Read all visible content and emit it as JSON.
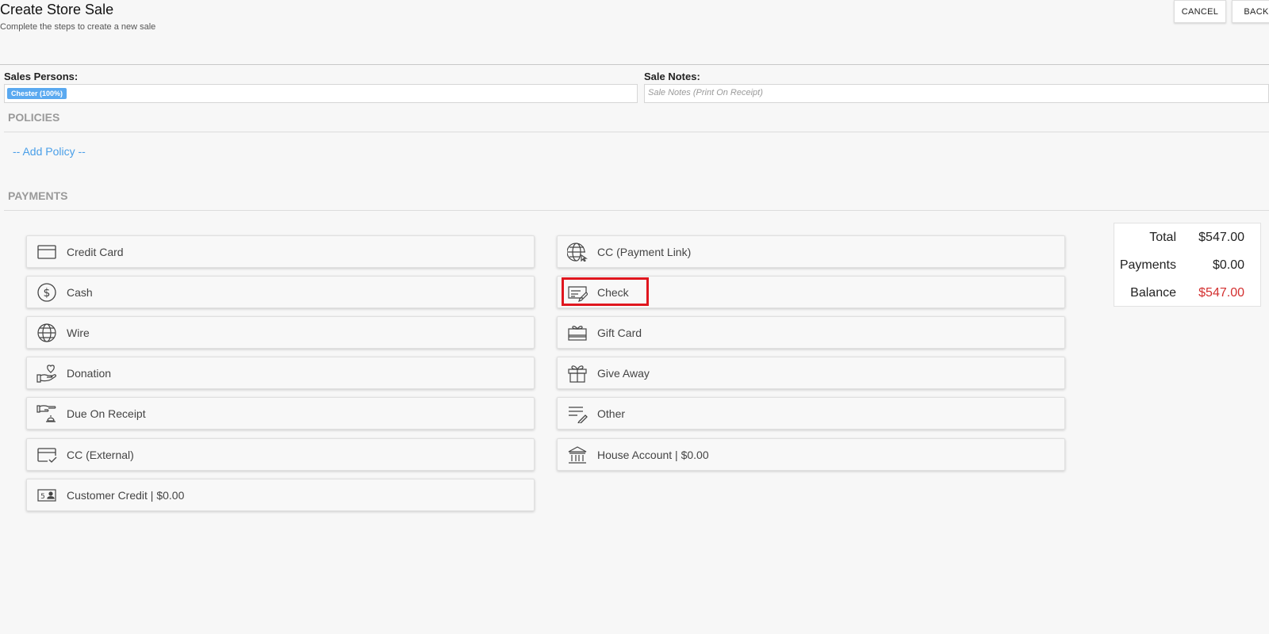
{
  "header": {
    "title": "Create Store Sale",
    "subtitle": "Complete the steps to create a new sale",
    "cancel_label": "CANCEL",
    "back_label": "BACK"
  },
  "sales_persons": {
    "label": "Sales Persons:",
    "chip": "Chester (100%)"
  },
  "sale_notes": {
    "label": "Sale Notes:",
    "placeholder": "Sale Notes (Print On Receipt)"
  },
  "policies": {
    "title": "POLICIES",
    "add_label": "-- Add Policy --"
  },
  "payments": {
    "title": "PAYMENTS",
    "left": [
      {
        "label": "Credit Card",
        "icon": "credit-card-icon"
      },
      {
        "label": "Cash",
        "icon": "dollar-coin-icon"
      },
      {
        "label": "Wire",
        "icon": "globe-icon"
      },
      {
        "label": "Donation",
        "icon": "heart-hand-icon"
      },
      {
        "label": "Due On Receipt",
        "icon": "hand-bell-icon"
      },
      {
        "label": "CC (External)",
        "icon": "card-check-icon"
      },
      {
        "label": "Customer Credit | $0.00",
        "icon": "id-card-icon"
      }
    ],
    "right": [
      {
        "label": "CC (Payment Link)",
        "icon": "globe-cursor-icon"
      },
      {
        "label": "Check",
        "icon": "check-pen-icon"
      },
      {
        "label": "Gift Card",
        "icon": "gift-card-icon"
      },
      {
        "label": "Give Away",
        "icon": "gift-box-icon"
      },
      {
        "label": "Other",
        "icon": "list-pen-icon"
      },
      {
        "label": "House Account | $0.00",
        "icon": "bank-icon"
      }
    ]
  },
  "summary": {
    "total_label": "Total",
    "total_value": "$547.00",
    "payments_label": "Payments",
    "payments_value": "$0.00",
    "balance_label": "Balance",
    "balance_value": "$547.00",
    "balance_color": "#d32f2f"
  },
  "colors": {
    "accent": "#4a9fe8",
    "chip": "#5aa9f0",
    "highlight": "#e0161e"
  }
}
